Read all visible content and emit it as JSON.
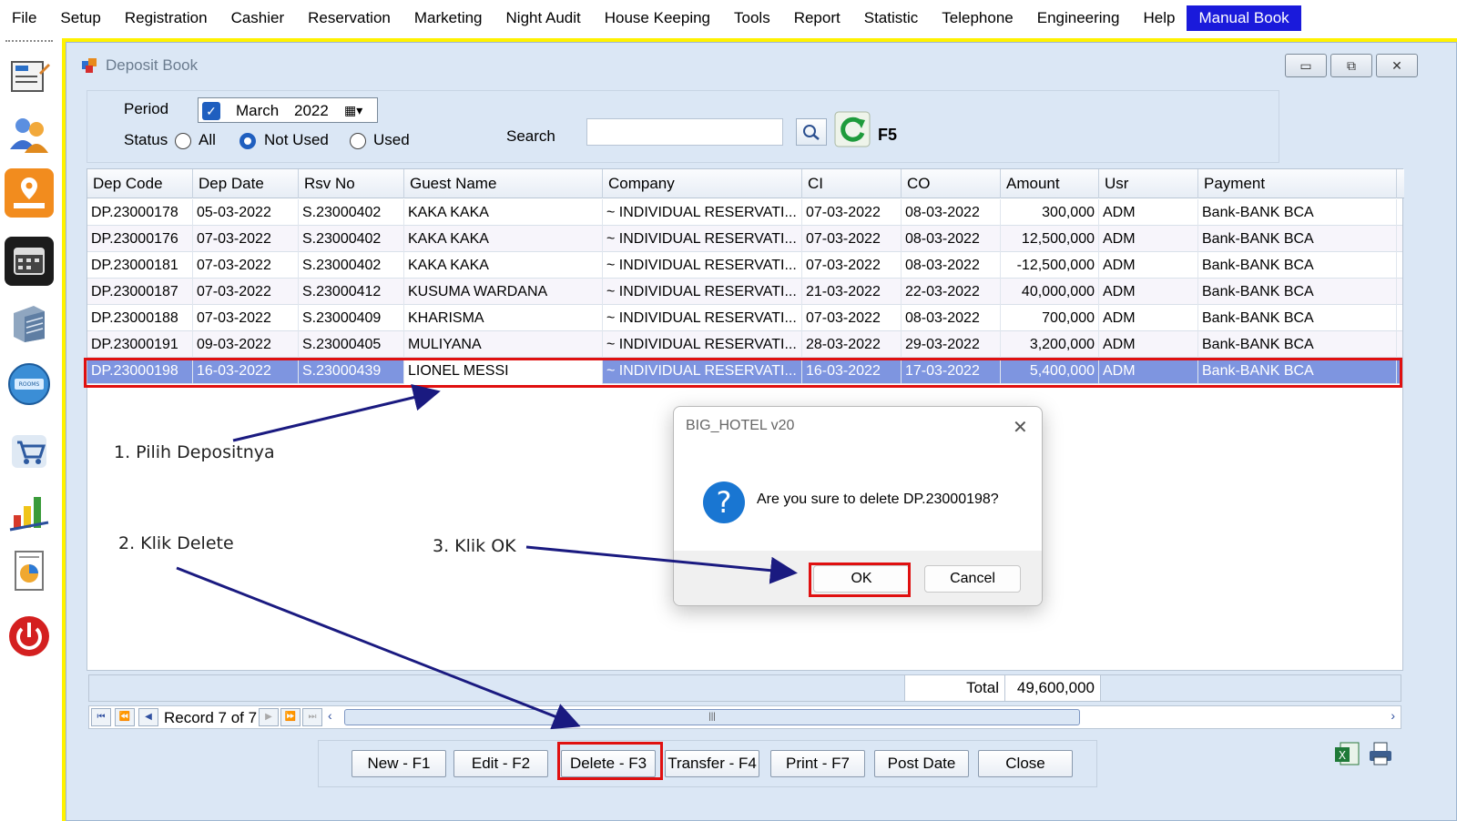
{
  "menu": [
    "File",
    "Setup",
    "Registration",
    "Cashier",
    "Reservation",
    "Marketing",
    "Night Audit",
    "House Keeping",
    "Tools",
    "Report",
    "Statistic",
    "Telephone",
    "Engineering",
    "Help"
  ],
  "menu_active": "Manual Book",
  "left_toolbar": [
    "registration-form-icon",
    "guests-icon",
    "map-icon",
    "calendar-icon",
    "building-icon",
    "rooms-available-icon",
    "cart-icon",
    "chart-icon",
    "report-pie-icon",
    "power-icon"
  ],
  "rooms_badge": "ROOMS AVAILABLE",
  "window": {
    "title": "Deposit Book"
  },
  "filter": {
    "period_label": "Period",
    "period_month": "March",
    "period_year": "2022",
    "status_label": "Status",
    "status_options": [
      "All",
      "Not Used",
      "Used"
    ],
    "status_selected": "Not Used",
    "search_label": "Search",
    "search_value": "",
    "refresh_key": "F5"
  },
  "grid": {
    "columns": [
      "Dep Code",
      "Dep Date",
      "Rsv No",
      "Guest Name",
      "Company",
      "CI",
      "CO",
      "Amount",
      "Usr",
      "Payment"
    ],
    "rows": [
      [
        "DP.23000178",
        "05-03-2022",
        "S.23000402",
        "KAKA KAKA",
        "~ INDIVIDUAL RESERVATI...",
        "07-03-2022",
        "08-03-2022",
        "300,000",
        "ADM",
        "Bank-BANK BCA"
      ],
      [
        "DP.23000176",
        "07-03-2022",
        "S.23000402",
        "KAKA KAKA",
        "~ INDIVIDUAL RESERVATI...",
        "07-03-2022",
        "08-03-2022",
        "12,500,000",
        "ADM",
        "Bank-BANK BCA"
      ],
      [
        "DP.23000181",
        "07-03-2022",
        "S.23000402",
        "KAKA KAKA",
        "~ INDIVIDUAL RESERVATI...",
        "07-03-2022",
        "08-03-2022",
        "-12,500,000",
        "ADM",
        "Bank-BANK BCA"
      ],
      [
        "DP.23000187",
        "07-03-2022",
        "S.23000412",
        "KUSUMA WARDANA",
        "~ INDIVIDUAL RESERVATI...",
        "21-03-2022",
        "22-03-2022",
        "40,000,000",
        "ADM",
        "Bank-BANK BCA"
      ],
      [
        "DP.23000188",
        "07-03-2022",
        "S.23000409",
        "KHARISMA",
        "~ INDIVIDUAL RESERVATI...",
        "07-03-2022",
        "08-03-2022",
        "700,000",
        "ADM",
        "Bank-BANK BCA"
      ],
      [
        "DP.23000191",
        "09-03-2022",
        "S.23000405",
        "MULIYANA",
        "~ INDIVIDUAL RESERVATI...",
        "28-03-2022",
        "29-03-2022",
        "3,200,000",
        "ADM",
        "Bank-BANK BCA"
      ],
      [
        "DP.23000198",
        "16-03-2022",
        "S.23000439",
        "LIONEL MESSI",
        "~ INDIVIDUAL RESERVATI...",
        "16-03-2022",
        "17-03-2022",
        "5,400,000",
        "ADM",
        "Bank-BANK BCA"
      ]
    ],
    "selected_row": 6,
    "total_label": "Total",
    "total_value": "49,600,000"
  },
  "navigator": {
    "record_text": "Record 7 of 7"
  },
  "buttons": {
    "new": "New - F1",
    "edit": "Edit - F2",
    "delete": "Delete - F3",
    "transfer": "Transfer - F4",
    "print": "Print - F7",
    "post_date": "Post Date",
    "close": "Close"
  },
  "dialog": {
    "title": "BIG_HOTEL v20",
    "icon": "?",
    "message": "Are you sure to delete DP.23000198?",
    "ok": "OK",
    "cancel": "Cancel"
  },
  "annotations": {
    "step1": "1. Pilih Depositnya",
    "step2": "2. Klik Delete",
    "step3": "3. Klik OK"
  },
  "colors": {
    "menu_active_bg": "#1a1adb",
    "selection_row": "#7e95e0",
    "highlight_red": "#e01010",
    "arrow": "#1a1a80",
    "mdi_border": "#fff200"
  }
}
